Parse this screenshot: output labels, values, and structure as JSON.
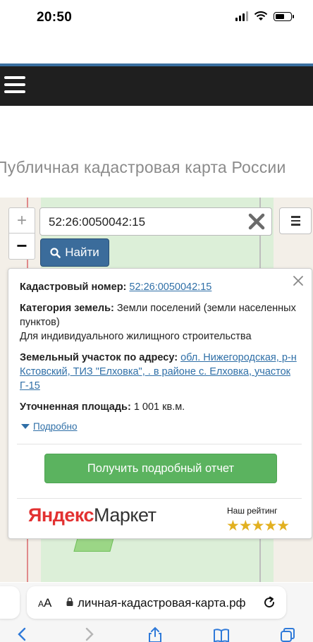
{
  "status_bar": {
    "time": "20:50"
  },
  "page": {
    "title": "Публичная кадастровая карта России"
  },
  "map": {
    "zoom_in": "+",
    "zoom_out": "−",
    "search_value": "52:26:0050042:15",
    "find_label": "Найти"
  },
  "popup": {
    "cadastral_label": "Кадастровый номер:",
    "cadastral_value": "52:26:0050042:15",
    "category_label": "Категория земель:",
    "category_value": "Земли поселений (земли населенных пунктов)",
    "usage_value": "Для индивидуального жилищного строительства",
    "address_label": "Земельный участок по адресу:",
    "address_value": "обл. Нижегородская, р-н Кстовский, ТИЗ \"Елховка\", . в районе с. Елховка, участок Г-15",
    "area_label": "Уточненная площадь:",
    "area_value": "1 001 кв.м.",
    "more_label": "Подробно",
    "report_button": "Получить подробный отчет",
    "yandex_brand_ya": "Яндекс",
    "yandex_brand_market": "Маркет",
    "rating_label": "Наш рейтинг",
    "rating_stars": 5
  },
  "browser": {
    "aa_label": "AA",
    "url": "личная-кадастровая-карта.рф"
  },
  "colors": {
    "navbar": "#1f1f1f",
    "accent_blue": "#3b6c9b",
    "report_green": "#5bb35f",
    "link": "#2f6fa7"
  }
}
